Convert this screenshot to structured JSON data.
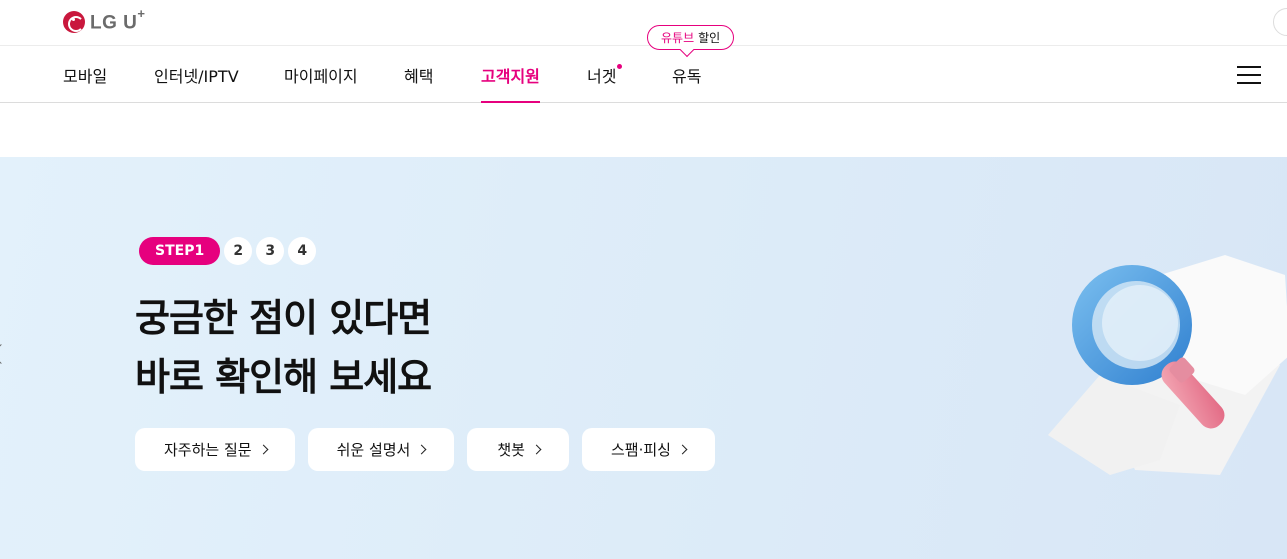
{
  "brand": {
    "logo_text": "LG U",
    "logo_sup": "+"
  },
  "promo": {
    "highlight": "유튜브",
    "text": "할인"
  },
  "gnb": {
    "items": [
      {
        "label": "모바일",
        "active": false
      },
      {
        "label": "인터넷/IPTV",
        "active": false
      },
      {
        "label": "마이페이지",
        "active": false
      },
      {
        "label": "혜택",
        "active": false
      },
      {
        "label": "고객지원",
        "active": true
      },
      {
        "label": "너겟",
        "active": false,
        "dot": true
      },
      {
        "label": "유독",
        "active": false
      }
    ],
    "menu_icon": "hamburger-menu-icon"
  },
  "hero": {
    "steps": {
      "active": "STEP1",
      "others": [
        "2",
        "3",
        "4"
      ]
    },
    "headline": [
      "궁금한 점이 있다면",
      "바로 확인해 보세요"
    ],
    "buttons": [
      "자주하는 질문",
      "쉬운 설명서",
      "챗봇",
      "스팸·피싱"
    ],
    "illustration": "magnifying-glass-over-document",
    "background": "#dfeefa",
    "accent": "#e6007e"
  }
}
